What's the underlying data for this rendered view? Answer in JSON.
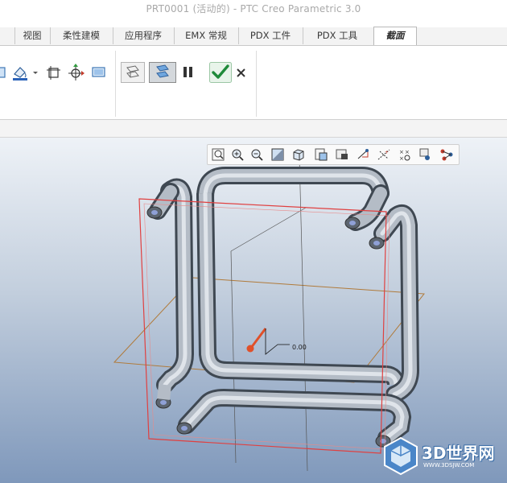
{
  "window": {
    "title": "PRT0001 (活动的) - PTC Creo Parametric 3.0"
  },
  "ribbon": {
    "tabs": [
      {
        "label": "视图"
      },
      {
        "label": "柔性建模"
      },
      {
        "label": "应用程序"
      },
      {
        "label": "EMX 常规"
      },
      {
        "label": "PDX 工件"
      },
      {
        "label": "PDX 工具"
      },
      {
        "label": "截面"
      }
    ],
    "active_tab": "截面",
    "icons": [
      "cap-display-icon",
      "color-dropdown-icon",
      "zone-icon",
      "move-dragger-icon",
      "preview-icon",
      "slice-solid-icon",
      "slice-quilt-icon",
      "pause-icon",
      "confirm-check-icon",
      "cancel-x-icon"
    ]
  },
  "view_toolbar": {
    "icons": [
      "zoom-refit-icon",
      "zoom-in-icon",
      "zoom-out-icon",
      "repaint-icon",
      "display-style-icon",
      "saved-views-icon",
      "view-manager-icon",
      "perspective-icon",
      "datum-display-icon",
      "annotation-display-icon",
      "spin-center-icon",
      "route-icon"
    ]
  },
  "model": {
    "dimension_value": "0.00"
  },
  "watermark": {
    "main": "3D世界网",
    "sub": "WWW.3DSJW.COM"
  },
  "colors": {
    "viewport_top": "#eef2f7",
    "viewport_bottom": "#7f98bb",
    "pipe_light": "#b4bcc6",
    "pipe_dark": "#6e7884",
    "section_plane": "#e04040",
    "datum_plane": "#b07a3a",
    "accent_check": "#1f8a3a"
  }
}
